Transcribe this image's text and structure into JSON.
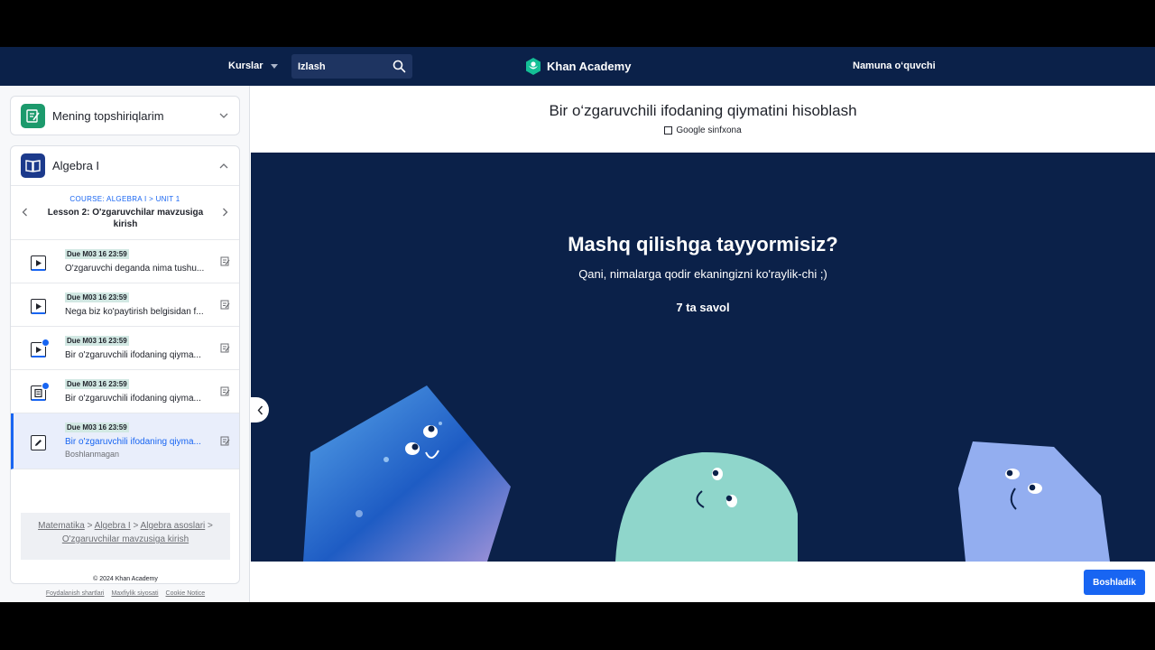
{
  "nav": {
    "courses_label": "Kurslar",
    "search_placeholder": "Izlash",
    "brand": "Khan Academy",
    "user": "Namuna o‘quvchi"
  },
  "sidebar": {
    "assignments_title": "Mening topshiriqlarim",
    "course_title": "Algebra I",
    "unit_course": "COURSE: ALGEBRA I > UNIT 1",
    "lesson": "Lesson 2: O'zgaruvchilar mavzusiga kirish",
    "tasks": [
      {
        "due": "Due M03 16 23:59",
        "title": "O'zgaruvchi deganda nima tushu...",
        "kind": "video"
      },
      {
        "due": "Due M03 16 23:59",
        "title": "Nega biz ko'paytirish belgisidan f...",
        "kind": "video"
      },
      {
        "due": "Due M03 16 23:59",
        "title": "Bir o'zgaruvchili ifodaning qiyma...",
        "kind": "video-done"
      },
      {
        "due": "Due M03 16 23:59",
        "title": "Bir o'zgaruvchili ifodaning qiyma...",
        "kind": "article-done"
      },
      {
        "due": "Due M03 16 23:59",
        "title": "Bir o'zgaruvchili ifodaning qiyma...",
        "kind": "exercise",
        "status": "Boshlanmagan"
      }
    ],
    "breadcrumbs": [
      "Matematika",
      "Algebra I",
      "Algebra asoslari",
      "O'zgaruvchilar mavzusiga kirish"
    ],
    "copyright": "© 2024 Khan Academy",
    "footer_links": [
      "Foydalanish shartlari",
      "Maxfiylik siyosati",
      "Cookie Notice"
    ]
  },
  "main": {
    "title": "Bir o‘zgaruvchili ifodaning qiymatini hisoblash",
    "google_classroom": "Google sinfxona",
    "hero_title": "Mashq qilishga tayyormisiz?",
    "hero_subtitle": "Qani, nimalarga qodir ekaningizni ko'raylik-chi ;)",
    "question_count": "7 ta savol",
    "start_button": "Boshladik"
  },
  "colors": {
    "nav_bg": "#0b2149",
    "hero_bg": "#0b2149",
    "accent": "#1865f2",
    "due_badge": "#d2e8e3"
  }
}
